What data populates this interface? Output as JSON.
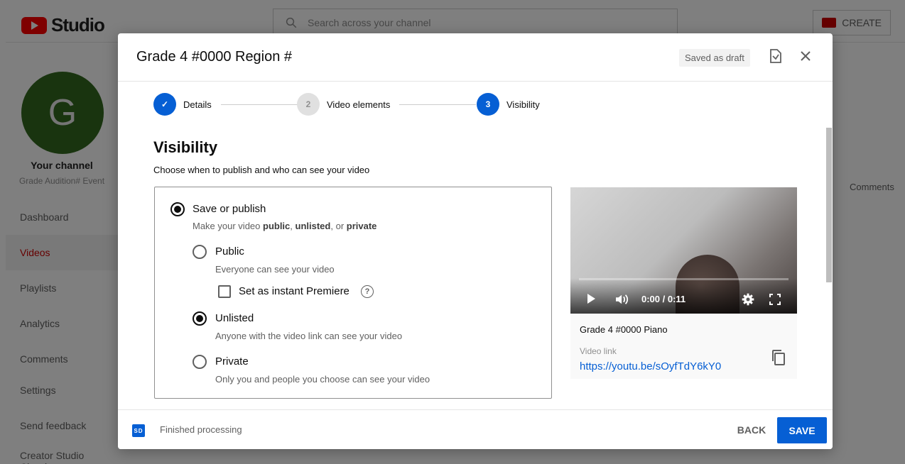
{
  "topbar": {
    "logo_text": "Studio",
    "search_placeholder": "Search across your channel",
    "create_label": "CREATE"
  },
  "sidebar": {
    "avatar_letter": "G",
    "channel_name": "Your channel",
    "channel_sub": "Grade Audition# Event",
    "items": [
      {
        "label": "Dashboard"
      },
      {
        "label": "Videos"
      },
      {
        "label": "Playlists"
      },
      {
        "label": "Analytics"
      },
      {
        "label": "Comments"
      },
      {
        "label": "Settings"
      },
      {
        "label": "Send feedback"
      },
      {
        "label": "Creator Studio Classic"
      }
    ]
  },
  "background": {
    "comments_col": "Comments"
  },
  "dialog": {
    "title": "Grade 4 #0000 Region #",
    "draft_badge": "Saved as draft",
    "steps": [
      {
        "number": "✓",
        "label": "Details",
        "state": "done"
      },
      {
        "number": "2",
        "label": "Video elements",
        "state": "todo"
      },
      {
        "number": "3",
        "label": "Visibility",
        "state": "current"
      }
    ],
    "section_title": "Visibility",
    "section_desc": "Choose when to publish and who can see your video",
    "options": {
      "save_publish": {
        "label": "Save or publish",
        "desc_prefix": "Make your video ",
        "desc_public": "public",
        "desc_sep": ", ",
        "desc_unlisted": "unlisted",
        "desc_or": ", or ",
        "desc_private": "private",
        "selected": true
      },
      "public": {
        "label": "Public",
        "desc": "Everyone can see your video",
        "selected": false
      },
      "premiere": {
        "label": "Set as instant Premiere",
        "checked": false,
        "help": "?"
      },
      "unlisted": {
        "label": "Unlisted",
        "desc": "Anyone with the video link can see your video",
        "selected": true
      },
      "private": {
        "label": "Private",
        "desc": "Only you and people you choose can see your video",
        "selected": false
      }
    },
    "preview": {
      "time": "0:00 / 0:11",
      "video_title": "Grade 4 #0000 Piano",
      "link_label": "Video link",
      "link_url": "https://youtu.be/sOyfTdY6kY0"
    },
    "footer": {
      "processing_icon_text": "SD",
      "processing_text": "Finished processing",
      "back_label": "BACK",
      "save_label": "SAVE"
    }
  },
  "colors": {
    "accent": "#065fd4",
    "brand_red": "#ff0000",
    "avatar_bg": "#33691e"
  }
}
